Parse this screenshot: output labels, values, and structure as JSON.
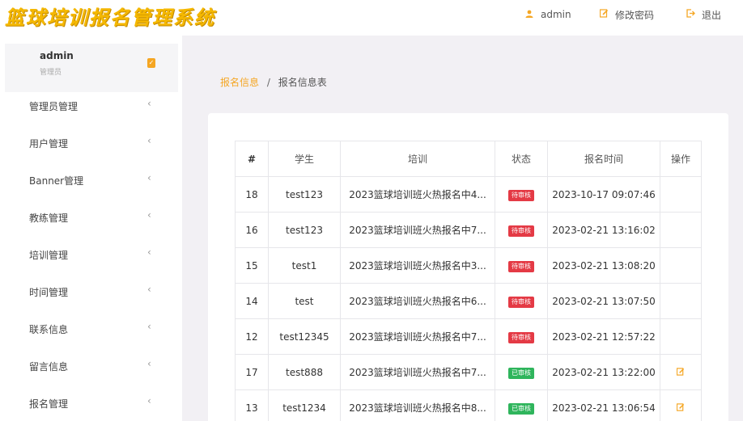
{
  "app": {
    "title": "篮球培训报名管理系统"
  },
  "header": {
    "user_label": "admin",
    "change_password_label": "修改密码",
    "logout_label": "退出"
  },
  "sidebar": {
    "user": {
      "name": "admin",
      "role": "管理员"
    },
    "items": [
      {
        "label": "管理员管理"
      },
      {
        "label": "用户管理"
      },
      {
        "label": "Banner管理"
      },
      {
        "label": "教练管理"
      },
      {
        "label": "培训管理"
      },
      {
        "label": "时间管理"
      },
      {
        "label": "联系信息"
      },
      {
        "label": "留言信息"
      },
      {
        "label": "报名管理"
      }
    ]
  },
  "breadcrumb": {
    "parent": "报名信息",
    "separator": "/",
    "current": "报名信息表"
  },
  "table": {
    "columns": [
      "#",
      "学生",
      "培训",
      "状态",
      "报名时间",
      "操作"
    ],
    "rows": [
      {
        "id": "18",
        "student": "test123",
        "training": "2023篮球培训班火热报名中4...",
        "status": "待审核",
        "status_type": "pending",
        "time": "2023-10-17 09:07:46",
        "action": false
      },
      {
        "id": "16",
        "student": "test123",
        "training": "2023篮球培训班火热报名中7...",
        "status": "待审核",
        "status_type": "pending",
        "time": "2023-02-21 13:16:02",
        "action": false
      },
      {
        "id": "15",
        "student": "test1",
        "training": "2023篮球培训班火热报名中3...",
        "status": "待审核",
        "status_type": "pending",
        "time": "2023-02-21 13:08:20",
        "action": false
      },
      {
        "id": "14",
        "student": "test",
        "training": "2023篮球培训班火热报名中6...",
        "status": "待审核",
        "status_type": "pending",
        "time": "2023-02-21 13:07:50",
        "action": false
      },
      {
        "id": "12",
        "student": "test12345",
        "training": "2023篮球培训班火热报名中7...",
        "status": "待审核",
        "status_type": "pending",
        "time": "2023-02-21 12:57:22",
        "action": false
      },
      {
        "id": "17",
        "student": "test888",
        "training": "2023篮球培训班火热报名中7...",
        "status": "已审核",
        "status_type": "approved",
        "time": "2023-02-21 13:22:00",
        "action": true
      },
      {
        "id": "13",
        "student": "test1234",
        "training": "2023篮球培训班火热报名中8...",
        "status": "已审核",
        "status_type": "approved",
        "time": "2023-02-21 13:06:54",
        "action": true
      }
    ]
  },
  "icons": {
    "user": "user-icon",
    "edit": "edit-icon",
    "logout": "logout-icon",
    "arrow": "chevron-left-icon"
  },
  "colors": {
    "accent": "#f5a623",
    "logo": "#f5b800",
    "pending": "#e43a45",
    "approved": "#2fb55c",
    "main_bg": "#f2f0f4"
  }
}
